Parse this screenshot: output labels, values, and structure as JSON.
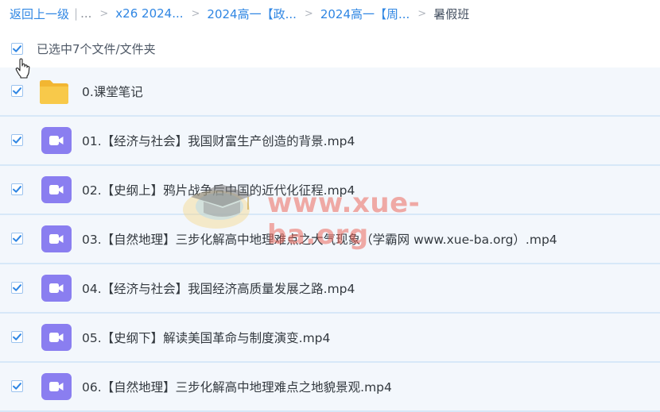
{
  "breadcrumb": {
    "back_label": "返回上一级",
    "separator": "|",
    "ellipsis": "...",
    "crumbs": [
      "x26 2024...",
      "2024高一【政...",
      "2024高一【周..."
    ],
    "current": "暑假班"
  },
  "selection": {
    "label": "已选中7个文件/文件夹",
    "checked": true
  },
  "files": [
    {
      "name": "0.课堂笔记",
      "type": "folder",
      "icon": "folder-icon",
      "checked": true
    },
    {
      "name": "01.【经济与社会】我国财富生产创造的背景.mp4",
      "type": "video",
      "icon": "video-icon",
      "checked": true
    },
    {
      "name": "02.【史纲上】鸦片战争后中国的近代化征程.mp4",
      "type": "video",
      "icon": "video-icon",
      "checked": true
    },
    {
      "name": "03.【自然地理】三步化解高中地理难点之大气现象（学霸网 www.xue-ba.org）.mp4",
      "type": "video",
      "icon": "video-icon",
      "checked": true
    },
    {
      "name": "04.【经济与社会】我国经济高质量发展之路.mp4",
      "type": "video",
      "icon": "video-icon",
      "checked": true
    },
    {
      "name": "05.【史纲下】解读美国革命与制度演变.mp4",
      "type": "video",
      "icon": "video-icon",
      "checked": true
    },
    {
      "name": "06.【自然地理】三步化解高中地理难点之地貌景观.mp4",
      "type": "video",
      "icon": "video-icon",
      "checked": true
    }
  ],
  "watermark": {
    "text": "www.xue-ba.org",
    "icon": "graduation-cap-logo"
  },
  "colors": {
    "link": "#2f86e3",
    "row_bg": "#f3f7fc",
    "row_divider": "#d7e8f8",
    "video_icon": "#8a7ef0",
    "folder_icon": "#f7c744",
    "checkbox": "#2f86e3"
  }
}
